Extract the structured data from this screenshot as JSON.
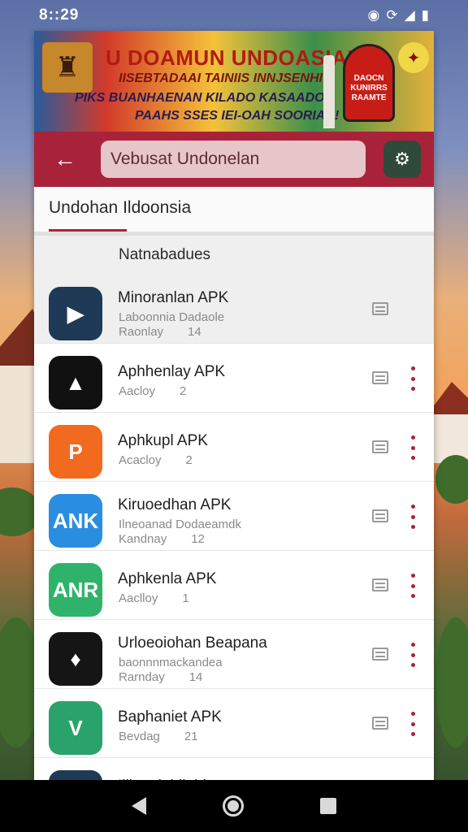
{
  "status_bar": {
    "time": "8::29",
    "icons": [
      "wifi-icon",
      "sync-icon",
      "signal-icon",
      "battery-icon"
    ]
  },
  "banner": {
    "title": "U DOAMUN UNDOASIAI",
    "line2": "IISEBTADAAI TAINIIS INNJSENHI",
    "line3": "PIKS BUANHAENAN KILADO KASAADOS",
    "line4": "PAAHS SSES IEI-OAH SOORIAN!",
    "badge": "DAOCN KUNIRRS RAAMTE"
  },
  "toolbar": {
    "search_value": "Vebusat Undonelan",
    "back_icon": "arrow-left-icon",
    "store_icon": "store-icon"
  },
  "tabs": {
    "active": "Undohan Ildoonsia"
  },
  "section": {
    "title": "Natnabadues"
  },
  "apps": [
    {
      "title": "Minoranlan APK",
      "subtitle": "Laboonnia Dadaole",
      "meta": "Raonlay",
      "count": "14",
      "color": "#1f3a57",
      "glyph": "▶"
    },
    {
      "title": "Aphhenlay APK",
      "subtitle": "",
      "meta": "Aacloy",
      "count": "2",
      "color": "#111111",
      "glyph": "▲"
    },
    {
      "title": "Aphkupl APK",
      "subtitle": "",
      "meta": "Acacloy",
      "count": "2",
      "color": "#f26a1f",
      "glyph": "P"
    },
    {
      "title": "Kiruoedhan APK",
      "subtitle": "Ilneoanad Dodaeamdk",
      "meta": "Kandnay",
      "count": "12",
      "color": "#2a8ee0",
      "glyph": "ANK"
    },
    {
      "title": "Aphkenla APK",
      "subtitle": "",
      "meta": "Aaclloy",
      "count": "1",
      "color": "#2fb36a",
      "glyph": "ANR"
    },
    {
      "title": "Urloeoiohan Beapana",
      "subtitle": "baonnnmackandea",
      "meta": "Rarnday",
      "count": "14",
      "color": "#151515",
      "glyph": "♦"
    },
    {
      "title": "Baphaniet APK",
      "subtitle": "",
      "meta": "Bevdag",
      "count": "21",
      "color": "#2aa36a",
      "glyph": "V"
    },
    {
      "title": "Iiiinanlahilahls",
      "subtitle": "",
      "meta": "",
      "count": "",
      "color": "#1f3a57",
      "glyph": "A"
    }
  ]
}
